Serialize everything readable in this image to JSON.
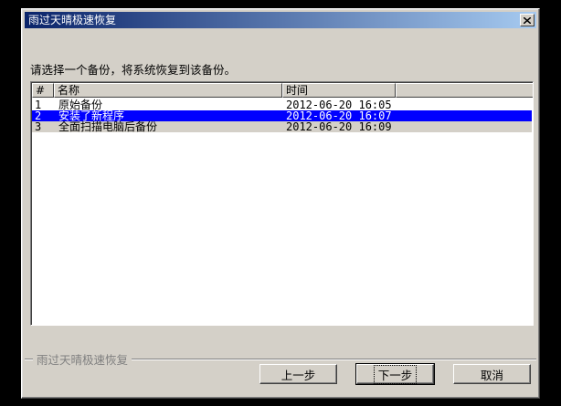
{
  "window": {
    "title": "雨过天晴极速恢复",
    "close_icon": "close-icon"
  },
  "instruction": "请选择一个备份，将系统恢复到该备份。",
  "list": {
    "columns": [
      "#",
      "名称",
      "时间"
    ],
    "rows": [
      {
        "num": "1",
        "name": "原始备份",
        "time": "2012-06-20 16:05"
      },
      {
        "num": "2",
        "name": "安装了新程序",
        "time": "2012-06-20 16:07"
      },
      {
        "num": "3",
        "name": "全面扫描电脑后备份",
        "time": "2012-06-20 16:09"
      }
    ],
    "selected_index": 1
  },
  "footer": {
    "brand": "雨过天晴极速恢复"
  },
  "buttons": {
    "prev": "上一步",
    "next": "下一步",
    "cancel": "取消"
  },
  "colors": {
    "selection": "#0000ff",
    "title_gradient_start": "#0a246a",
    "title_gradient_end": "#a6caf0",
    "face": "#d4d0c8"
  }
}
